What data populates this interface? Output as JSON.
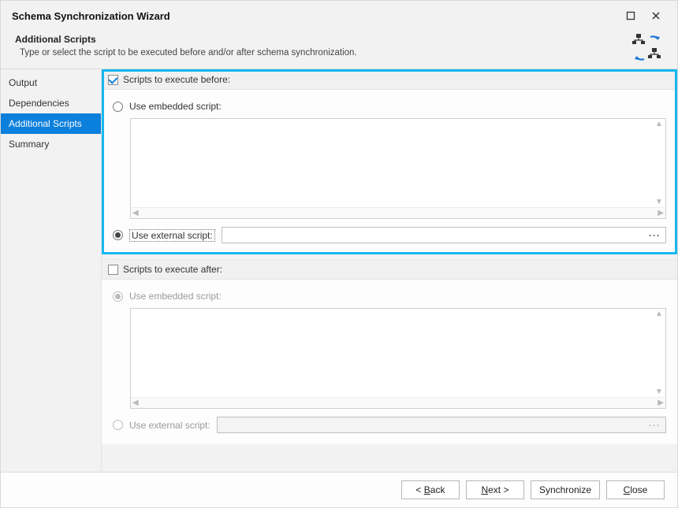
{
  "window": {
    "title": "Schema Synchronization Wizard",
    "subtitle": "Additional Scripts",
    "description": "Type or select the script to be executed before and/or after schema synchronization."
  },
  "sidebar": {
    "items": [
      {
        "label": "Output",
        "active": false
      },
      {
        "label": "Dependencies",
        "active": false
      },
      {
        "label": "Additional Scripts",
        "active": true
      },
      {
        "label": "Summary",
        "active": false
      }
    ]
  },
  "sections": {
    "before": {
      "checkbox_label": "Scripts to execute before:",
      "checked": true,
      "embedded_label": "Use embedded script:",
      "embedded_selected": false,
      "external_label": "Use external script:",
      "external_selected": true,
      "external_value": ""
    },
    "after": {
      "checkbox_label": "Scripts to execute after:",
      "checked": false,
      "embedded_label": "Use embedded script:",
      "embedded_selected": true,
      "external_label": "Use external script:",
      "external_selected": false,
      "external_value": ""
    }
  },
  "footer": {
    "back": "< Back",
    "next": "Next >",
    "synchronize": "Synchronize",
    "close": "Close"
  }
}
